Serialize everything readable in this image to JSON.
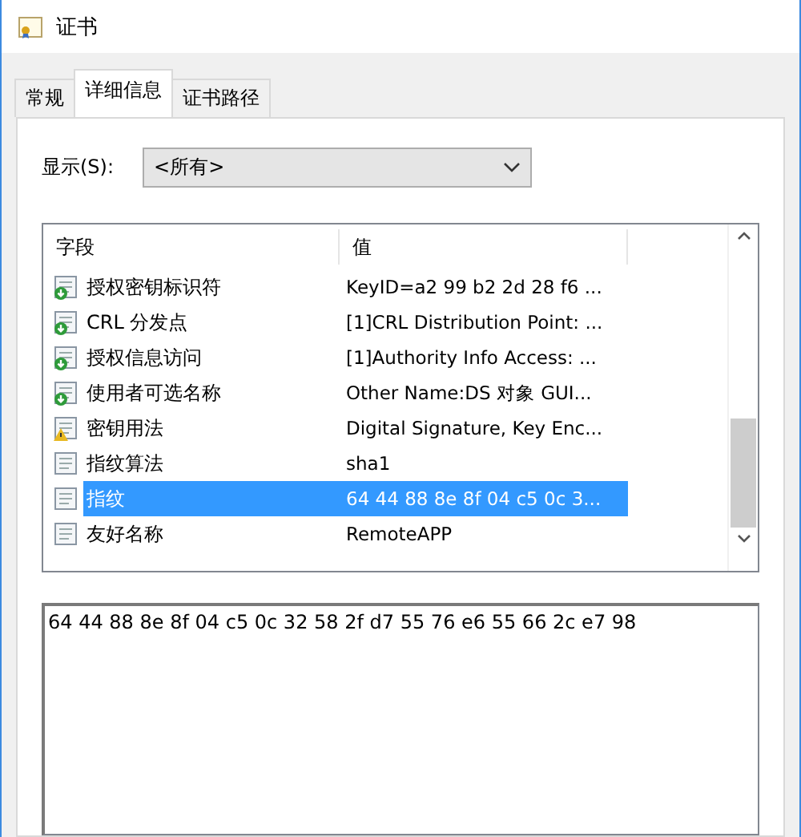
{
  "window": {
    "title": "证书"
  },
  "tabs": [
    {
      "label": "常规",
      "selected": false
    },
    {
      "label": "详细信息",
      "selected": true
    },
    {
      "label": "证书路径",
      "selected": false
    }
  ],
  "show": {
    "label": "显示(S):",
    "value": "<所有>"
  },
  "table": {
    "columns": [
      "字段",
      "值"
    ],
    "rows": [
      {
        "kind": "extension",
        "field": "授权密钥标识符",
        "value": "KeyID=a2 99 b2 2d 28 f6 ...",
        "selected": false
      },
      {
        "kind": "extension",
        "field": "CRL 分发点",
        "value": "[1]CRL Distribution Point: ...",
        "selected": false
      },
      {
        "kind": "extension",
        "field": "授权信息访问",
        "value": "[1]Authority Info Access: ...",
        "selected": false
      },
      {
        "kind": "extension",
        "field": "使用者可选名称",
        "value": "Other Name:DS 对象 GUI...",
        "selected": false
      },
      {
        "kind": "critical",
        "field": "密钥用法",
        "value": "Digital Signature, Key Enc...",
        "selected": false
      },
      {
        "kind": "property",
        "field": "指纹算法",
        "value": "sha1",
        "selected": false
      },
      {
        "kind": "property",
        "field": "指纹",
        "value": "64 44 88 8e 8f 04 c5 0c 3...",
        "selected": true
      },
      {
        "kind": "property",
        "field": "友好名称",
        "value": "RemoteAPP",
        "selected": false
      }
    ]
  },
  "detail": {
    "value": "64 44 88 8e 8f 04 c5 0c 32 58 2f d7 55 76 e6 55 66 2c e7 98"
  }
}
